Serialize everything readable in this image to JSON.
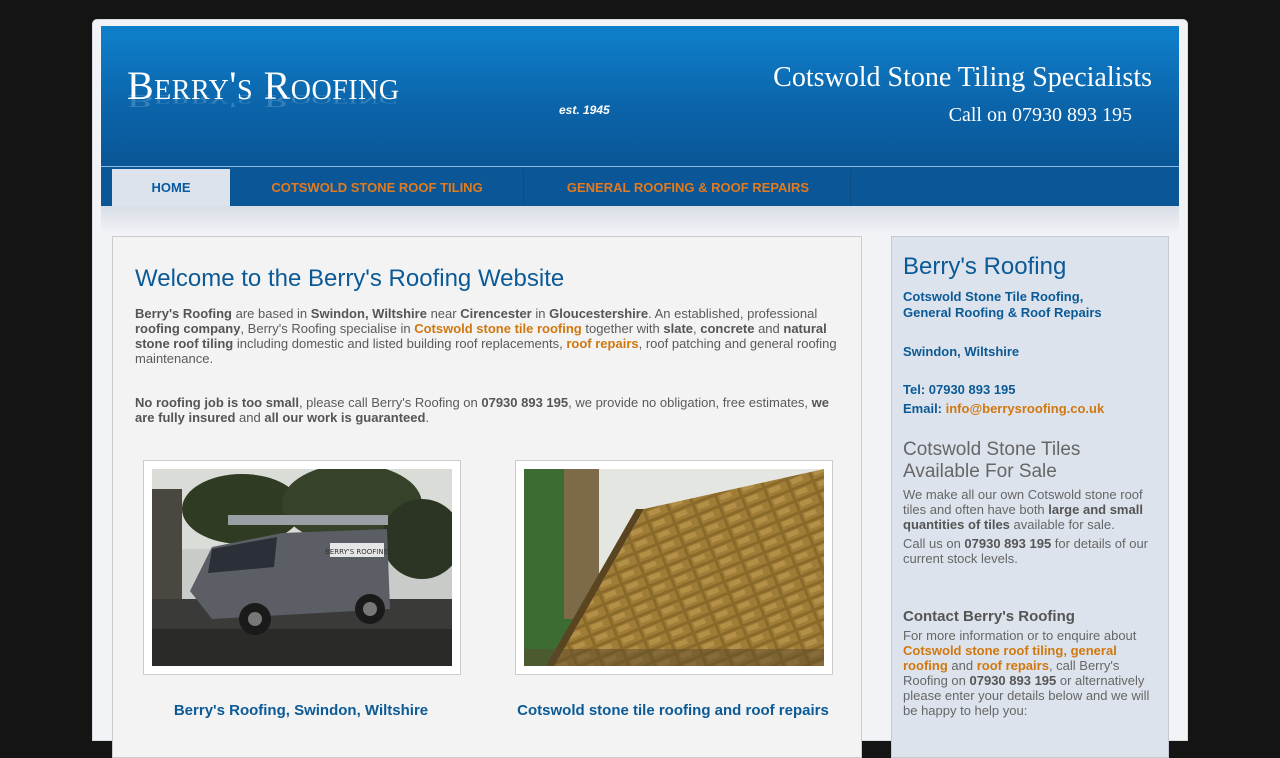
{
  "header": {
    "logo": "Berry's Roofing",
    "established": "est. 1945",
    "tagline": "Cotswold Stone Tiling Specialists",
    "phone": "Call on 07930 893 195"
  },
  "nav": {
    "items": [
      {
        "label": "HOME"
      },
      {
        "label": "COTSWOLD STONE ROOF TILING"
      },
      {
        "label": "GENERAL ROOFING & ROOF REPAIRS"
      }
    ]
  },
  "main": {
    "title": "Welcome to the Berry's Roofing Website",
    "intro": {
      "company": "Berry's Roofing",
      "t1": " are based in ",
      "town": "Swindon, Wiltshire",
      "t2": " near ",
      "city": "Cirencester",
      "t3": " in ",
      "county": "Gloucestershire",
      "t4": ". An established, professional ",
      "roofing_company": "roofing company",
      "t5": ", Berry's Roofing specialise in ",
      "link_cotswold": "Cotswold stone tile roofing",
      "t6": " together with ",
      "slate": "slate",
      "t7": ", ",
      "concrete": "concrete",
      "t8": " and ",
      "natural": "natural stone roof tiling",
      "t9": " including domestic and listed building roof replacements, ",
      "link_repairs": "roof repairs",
      "t10": ", roof patching and general roofing maintenance."
    },
    "second": {
      "no_job": "No roofing job is too small",
      "t1": ", please call Berry's Roofing on ",
      "phone": "07930 893 195",
      "t2": ", we provide no obligation, free estimates, ",
      "insured": "we are fully insured",
      "t3": " and ",
      "guaranteed": "all our work is guaranteed",
      "t4": "."
    },
    "captions": [
      "Berry's Roofing, Swindon, Wiltshire",
      "Cotswold stone tile roofing and roof repairs"
    ],
    "van_text": "BERRY'S ROOFING"
  },
  "sidebar": {
    "title": "Berry's Roofing",
    "services_line1": "Cotswold Stone Tile Roofing,",
    "services_line2": "General Roofing & Roof Repairs",
    "location": "Swindon, Wiltshire",
    "tel": "Tel: 07930 893 195",
    "email_label": "Email: ",
    "email": "info@berrysroofing.co.uk",
    "tiles_heading_1": "Cotswold Stone Tiles",
    "tiles_heading_2": "Available For Sale",
    "tiles_p1_a": "We make all our own Cotswold stone roof tiles and often have both ",
    "tiles_p1_b": "large and small quantities of tiles",
    "tiles_p1_c": " available for sale.",
    "tiles_p2_a": "Call us on ",
    "tiles_p2_phone": "07930 893 195",
    "tiles_p2_b": " for details of our current stock levels.",
    "contact_heading": "Contact Berry's Roofing",
    "contact_a": "For more information or to enquire about ",
    "contact_link1": "Cotswold stone roof tiling",
    "contact_b": ", ",
    "contact_link2": "general roofing",
    "contact_c": " and ",
    "contact_link3": "roof repairs",
    "contact_d": ", call Berry's Roofing on ",
    "contact_phone": "07930 893 195",
    "contact_e": " or alternatively please enter your details below and we will be happy to help you:"
  },
  "colors": {
    "header_blue": "#0b63a8",
    "link_orange": "#d0780f",
    "heading_blue": "#0b5a96",
    "page_bg": "#141414"
  }
}
